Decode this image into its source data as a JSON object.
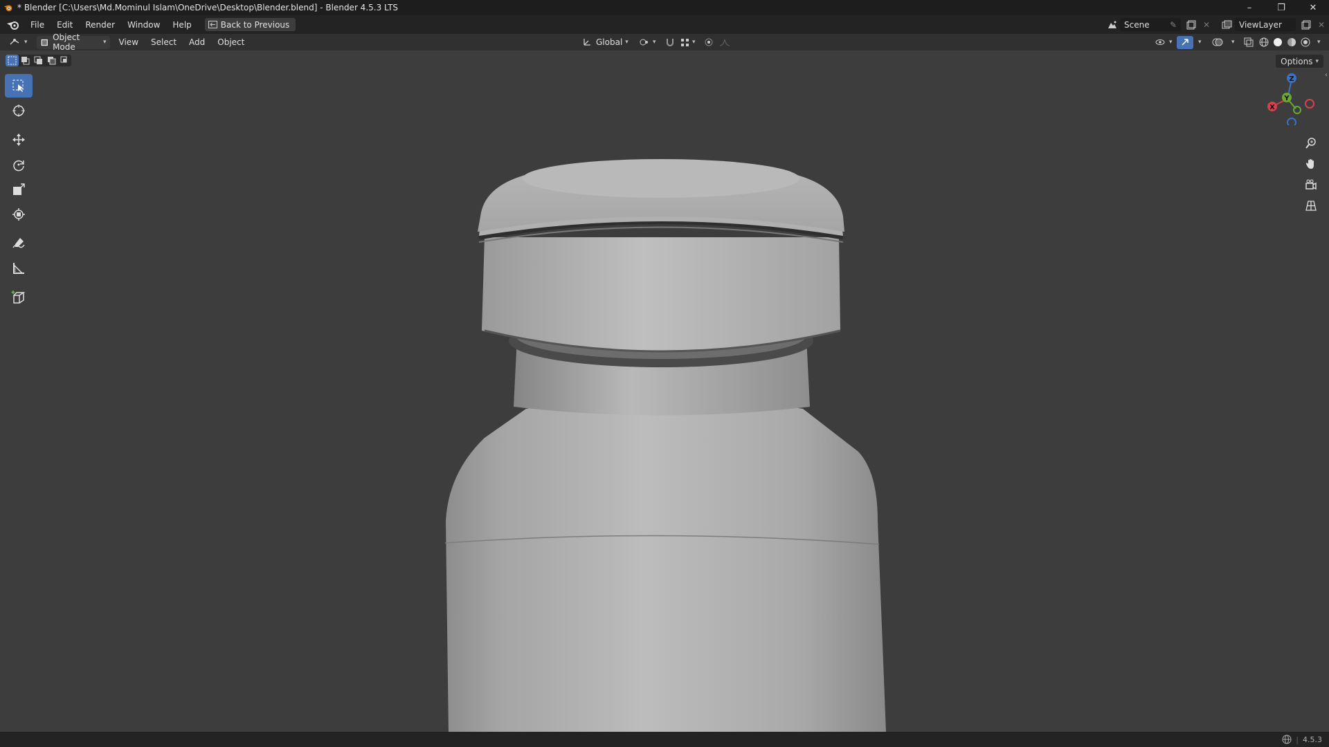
{
  "window": {
    "title": "* Blender [C:\\Users\\Md.Mominul Islam\\OneDrive\\Desktop\\Blender.blend] - Blender 4.5.3 LTS",
    "minimize": "–",
    "maximize": "❐",
    "close": "✕"
  },
  "menu": {
    "items": [
      "File",
      "Edit",
      "Render",
      "Window",
      "Help"
    ],
    "back_button": "Back to Previous",
    "scene": "Scene",
    "view_layer": "ViewLayer"
  },
  "header": {
    "mode": "Object Mode",
    "menus": [
      "View",
      "Select",
      "Add",
      "Object"
    ],
    "transform_orientation": "Global"
  },
  "viewport": {
    "options_label": "Options",
    "gizmo": {
      "x": "X",
      "y": "Y",
      "z": "Z"
    }
  },
  "status": {
    "version": "4.5.3"
  }
}
